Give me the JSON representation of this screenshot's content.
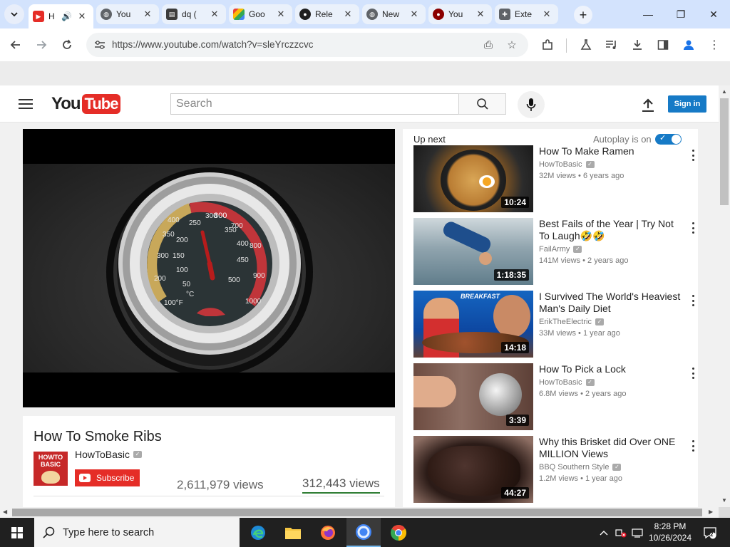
{
  "browser": {
    "tabs": [
      {
        "title": "H",
        "favicon": "youtube-favicon",
        "active": true,
        "audio": true
      },
      {
        "title": "You",
        "favicon": "globe-favicon"
      },
      {
        "title": "dq (",
        "favicon": "terminal-favicon"
      },
      {
        "title": "Goo",
        "favicon": "google-favicon"
      },
      {
        "title": "Rele",
        "favicon": "github-favicon"
      },
      {
        "title": "New",
        "favicon": "globe-favicon"
      },
      {
        "title": "You",
        "favicon": "record-favicon"
      },
      {
        "title": "Exte",
        "favicon": "puzzle-favicon"
      }
    ],
    "url": "https://www.youtube.com/watch?v=sleYrczzcvc"
  },
  "youtube": {
    "logo_you": "You",
    "logo_tube": "Tube",
    "search_placeholder": "Search",
    "sign_in": "Sign in",
    "video": {
      "title": "How To Smoke Ribs",
      "channel": "HowToBasic",
      "avatar_text": "HOWTO BASIC",
      "subscribe": "Subscribe",
      "views_a": "2,611,979 views",
      "views_b": "312,443 views"
    },
    "sidebar": {
      "up_next": "Up next",
      "autoplay": "Autoplay is on",
      "items": [
        {
          "title": "How To Make Ramen",
          "channel": "HowToBasic",
          "views": "32M views",
          "age": "6 years ago",
          "duration": "10:24"
        },
        {
          "title": "Best Fails of the Year | Try Not To Laugh🤣🤣",
          "channel": "FailArmy",
          "views": "141M views",
          "age": "2 years ago",
          "duration": "1:18:35"
        },
        {
          "title": "I Survived The World's Heaviest Man's Daily Diet",
          "channel": "ErikTheElectric",
          "views": "33M views",
          "age": "1 year ago",
          "duration": "14:18",
          "thumb_text": "BREAKFAST"
        },
        {
          "title": "How To Pick a Lock",
          "channel": "HowToBasic",
          "views": "6.8M views",
          "age": "2 years ago",
          "duration": "3:39"
        },
        {
          "title": "Why this Brisket did Over ONE MILLION Views",
          "channel": "BBQ Southern Style",
          "views": "1.2M views",
          "age": "1 year ago",
          "duration": "44:27"
        }
      ]
    }
  },
  "taskbar": {
    "search_placeholder": "Type here to search",
    "time": "8:28 PM",
    "date": "10/26/2024",
    "notification_count": "2"
  },
  "colors": {
    "youtube_red": "#e52d27",
    "signin_blue": "#167ac6",
    "chrome_tabstrip": "#d3e3fd"
  }
}
